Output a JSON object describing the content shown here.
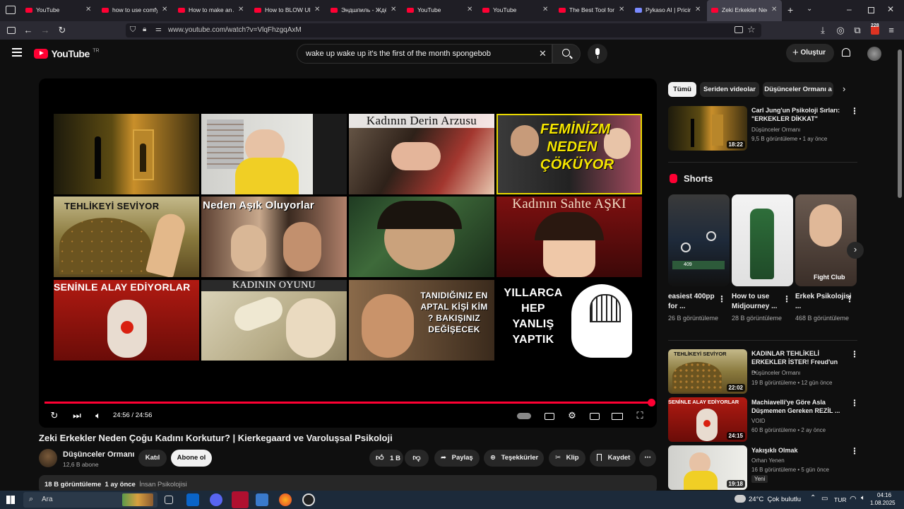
{
  "browser": {
    "tabs": [
      {
        "title": "YouTube"
      },
      {
        "title": "how to use comfyui"
      },
      {
        "title": "How to make an AI"
      },
      {
        "title": "How to BLOW UP y"
      },
      {
        "title": "Эндшпиль - Ждёшь"
      },
      {
        "title": "YouTube"
      },
      {
        "title": "YouTube"
      },
      {
        "title": "The Best Tool for Gr"
      },
      {
        "title": "Pykaso AI | Pricing"
      },
      {
        "title": "Zeki Erkekler Neden"
      }
    ],
    "url": "www.youtube.com/watch?v=VlqFhzgqAxM",
    "notification_badge": "228"
  },
  "yt": {
    "logo_text": "YouTube",
    "country": "TR",
    "search_value": "wake up wake up it's the first of the month spongebob",
    "create_label": "Oluştur"
  },
  "player": {
    "time": "24:56 / 24:56",
    "progress": 1.0,
    "captions": [
      "Kadının Derin Arzusu",
      "FEMİNİZM NEDEN ÇÖKÜYOR",
      "TEHLİKEYİ SEVİYOR",
      "Neden Aşık Oluyorlar",
      "Kadının Sahte AŞKI",
      "SENİNLE ALAY EDİYORLAR",
      "KADININ OYUNU",
      "TANIDIĞINIZ EN APTAL KİŞİ KİM ? BAKIŞINIZ DEĞİŞECEK",
      "YILLARCA HEP YANLIŞ YAPTIK"
    ]
  },
  "video": {
    "title": "Zeki Erkekler Neden Çoğu Kadını Korkutur? | Kierkegaard ve Varoluşsal Psikoloji",
    "channel": "Düşünceler Ormanı",
    "subs": "12,6 B abone",
    "join_label": "Katıl",
    "subscribe_label": "Abone ol",
    "likes": "1 B",
    "share_label": "Paylaş",
    "thanks_label": "Teşekkürler",
    "clip_label": "Klip",
    "save_label": "Kaydet",
    "views": "18 B görüntüleme",
    "age": "1 ay önce",
    "tag": "İnsan Psikolojisi"
  },
  "sidebar": {
    "chips": [
      "Tümü",
      "Seriden videolar",
      "Düşünceler Ormanı a"
    ],
    "rec1": {
      "title": "Carl Jung'un Psikoloji Sırları: \"ERKEKLER DİKKAT\"",
      "channel": "Düşünceler Ormanı",
      "meta": "9,5 B görüntüleme • 1 ay önce",
      "duration": "18:22"
    },
    "shorts_heading": "Shorts",
    "shorts": [
      {
        "title": "easiest 400pp for ...",
        "views": "26 B görüntüleme"
      },
      {
        "title": "How to use Midjourney ...",
        "views": "28 B görüntüleme"
      },
      {
        "title": "Erkek Psikolojisi ...",
        "views": "468 B görüntüleme"
      }
    ],
    "recs": [
      {
        "title": "KADINLAR TEHLİKELİ ERKEKLER İSTER! Freud'un ...",
        "channel": "Düşünceler Ormanı",
        "meta": "19 B görüntüleme • 12 gün önce",
        "duration": "22:02",
        "thumb_caption": "TEHLİKEYİ SEVİYOR"
      },
      {
        "title": "Machiavelli'ye Göre Asla Düşmemen Gereken REZİL ...",
        "channel": "VOID",
        "meta": "60 B görüntüleme • 2 ay önce",
        "duration": "24:15",
        "thumb_caption": "SENİNLE ALAY EDİYORLAR"
      },
      {
        "title": "Yakışıklı Olmak",
        "channel": "Orhan Yenen",
        "meta": "16 B görüntüleme • 5 gün önce",
        "duration": "19:18",
        "badge": "Yeni"
      }
    ],
    "shorts_overlay": [
      "409",
      "Fight Club"
    ]
  },
  "taskbar": {
    "search_placeholder": "Ara",
    "weather": "24°C  Çok bulutlu",
    "lang": "TUR",
    "time": "04:16",
    "date": "1.08.2025"
  }
}
